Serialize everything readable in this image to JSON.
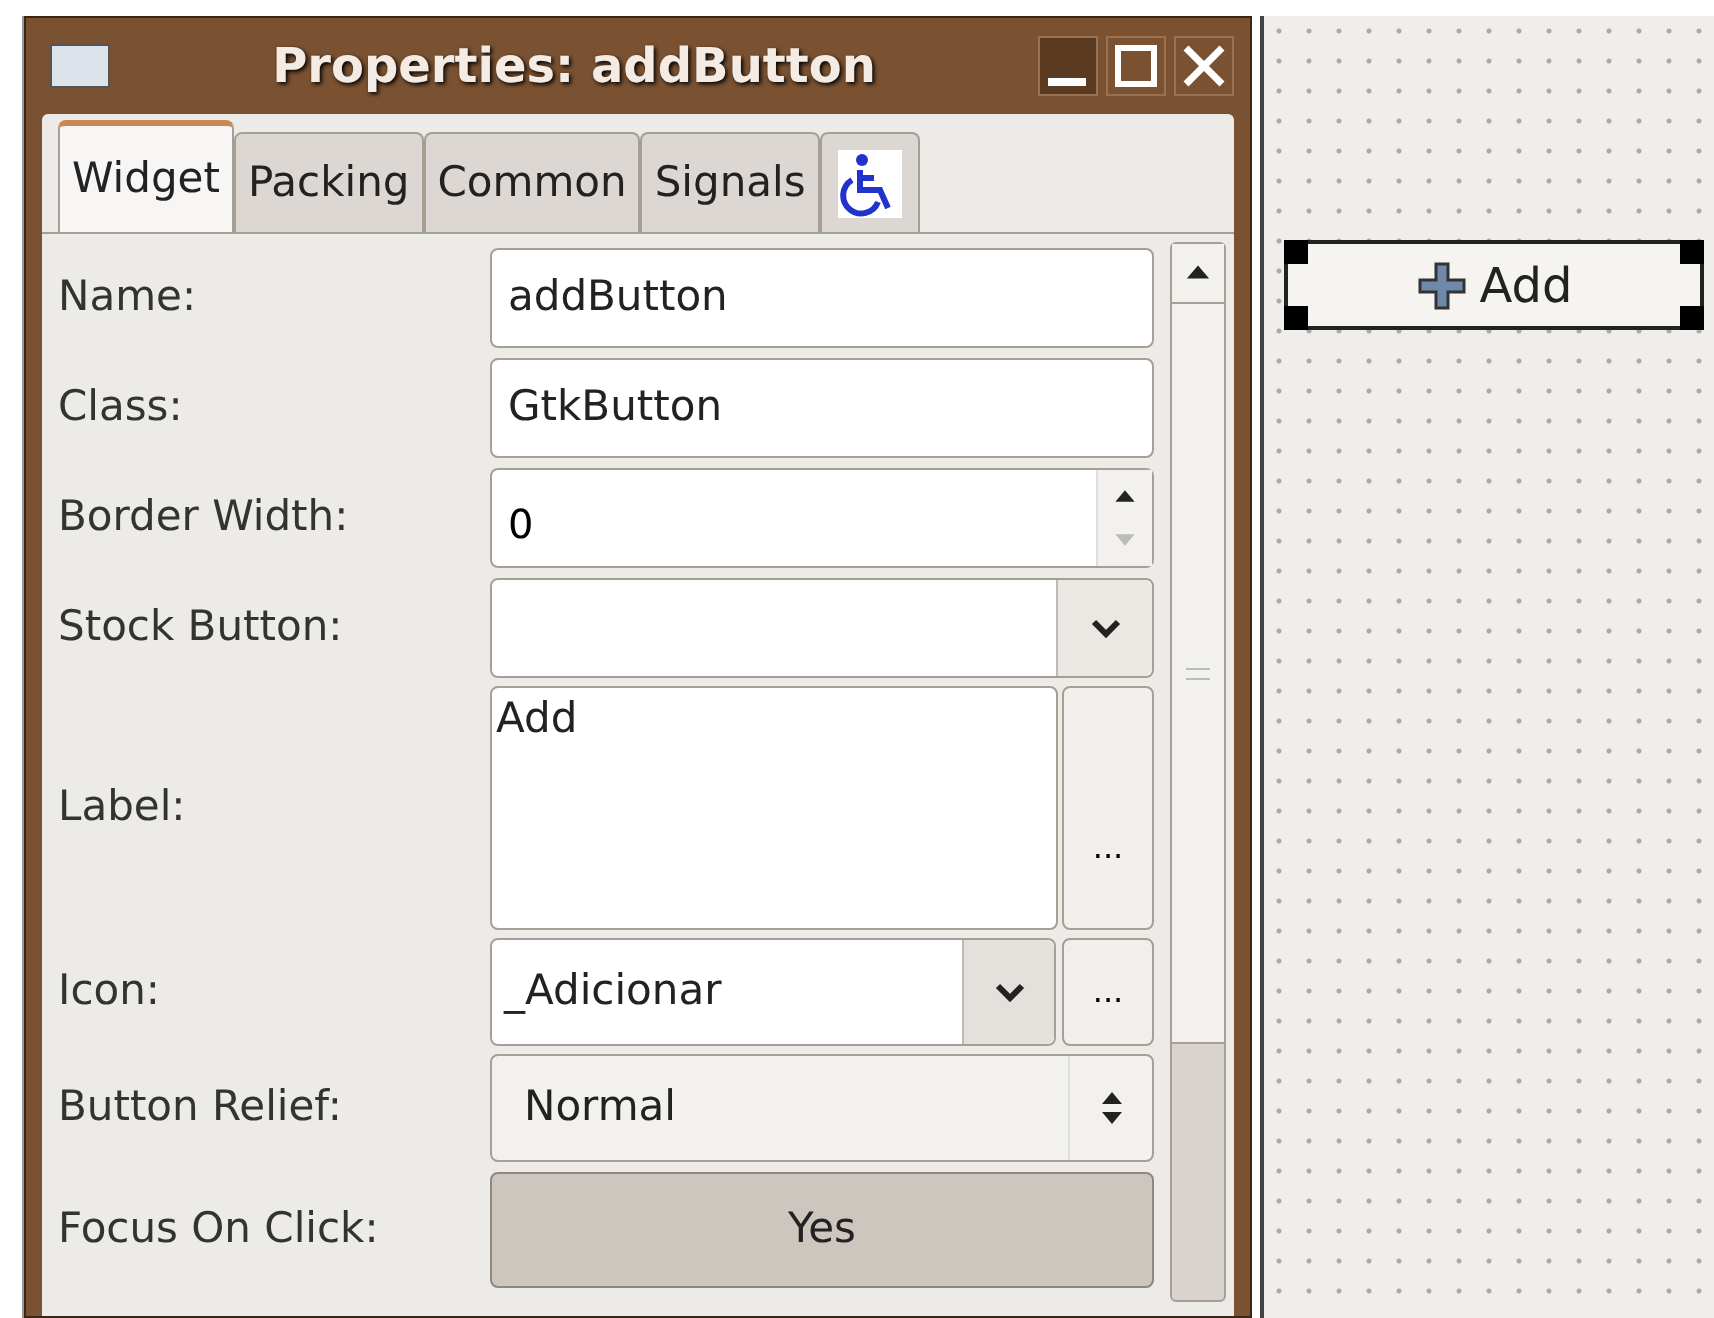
{
  "window": {
    "title": "Properties: addButton"
  },
  "tabs": [
    {
      "kind": "text",
      "label": "Widget",
      "selected": true
    },
    {
      "kind": "text",
      "label": "Packing",
      "selected": false
    },
    {
      "kind": "text",
      "label": "Common",
      "selected": false
    },
    {
      "kind": "text",
      "label": "Signals",
      "selected": false
    },
    {
      "kind": "accessibility",
      "selected": false
    }
  ],
  "properties": [
    {
      "kind": "entry",
      "label": "Name:",
      "value": "addButton"
    },
    {
      "kind": "entry",
      "label": "Class:",
      "value": "GtkButton"
    },
    {
      "kind": "spin",
      "label": "Border Width:",
      "value": "0"
    },
    {
      "kind": "combo",
      "label": "Stock Button:"
    },
    {
      "kind": "textarea",
      "label": "Label:",
      "value": "Add",
      "button": "..."
    },
    {
      "kind": "icon-combo",
      "label": "Icon:",
      "value": "_Adicionar",
      "button": "..."
    },
    {
      "kind": "select",
      "label": "Button Relief:",
      "value": "Normal"
    },
    {
      "kind": "toggle",
      "label": "Focus On Click:",
      "value": "Yes",
      "on": true
    }
  ],
  "canvas": {
    "button": {
      "label": "Add"
    }
  }
}
